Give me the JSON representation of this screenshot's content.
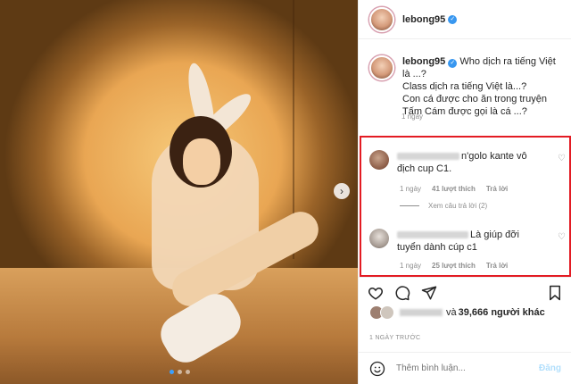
{
  "post": {
    "username": "lebong95",
    "verified_mark": "✓"
  },
  "caption": {
    "username": "lebong95",
    "lines": [
      "Who dịch ra tiếng Việt là ...?",
      "Class dịch ra tiếng Việt là...?",
      "Con cá được cho ăn trong truyện Tấm Cám được gọi là cá ...?"
    ],
    "time": "1 ngày"
  },
  "comments": [
    {
      "text": "n'golo kante vô địch cup C1.",
      "time": "1 ngày",
      "likes": "41 lượt thích",
      "reply": "Trả lời"
    },
    {
      "text": "Là giúp đỡi tuyển dành cúp c1",
      "time": "1 ngày",
      "likes": "25 lượt thích",
      "reply": "Trả lời"
    }
  ],
  "view_replies": "Xem câu trả lời (2)",
  "likes": {
    "conjunction": "và",
    "count": "39,666 người khác"
  },
  "post_time": "1 NGÀY TRƯỚC",
  "add_comment": {
    "placeholder": "Thêm bình luận...",
    "post_label": "Đăng"
  },
  "photo": {
    "carousel_count": 3,
    "active_index": 0,
    "next_arrow": "›"
  },
  "colors": {
    "highlight_border": "#e31b23",
    "verified": "#3897f0",
    "post_button_disabled": "#b2dffc",
    "active_dot": "#3aa0ff"
  }
}
